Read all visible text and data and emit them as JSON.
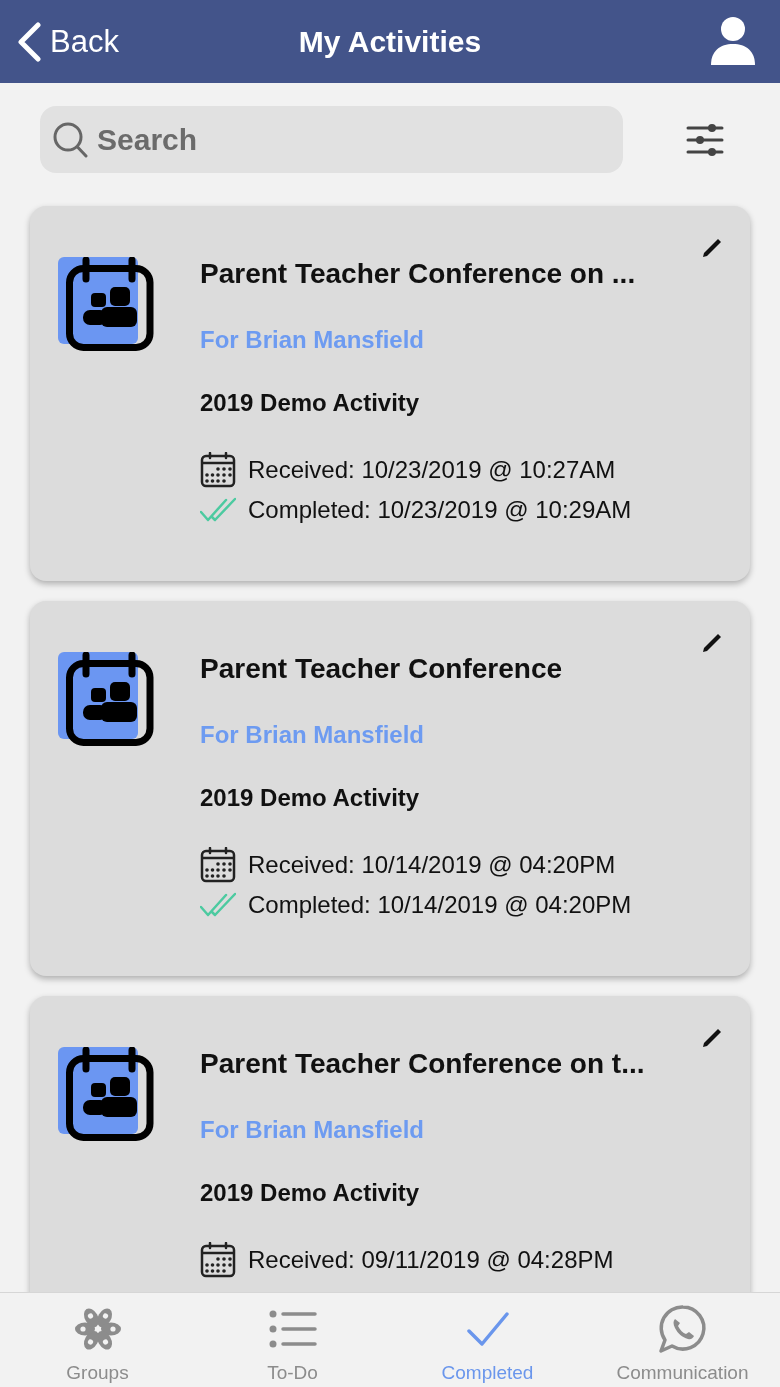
{
  "header": {
    "back_label": "Back",
    "title": "My Activities"
  },
  "search": {
    "placeholder": "Search"
  },
  "activities": [
    {
      "title": "Parent Teacher Conference on ...",
      "recipient": "For Brian Mansfield",
      "activity": "2019 Demo Activity",
      "timestamps": [
        {
          "kind": "received",
          "text": "Received: 10/23/2019 @ 10:27AM"
        },
        {
          "kind": "completed",
          "text": "Completed: 10/23/2019 @ 10:29AM"
        }
      ]
    },
    {
      "title": "Parent Teacher Conference",
      "recipient": "For Brian Mansfield",
      "activity": "2019 Demo Activity",
      "timestamps": [
        {
          "kind": "received",
          "text": "Received: 10/14/2019 @ 04:20PM"
        },
        {
          "kind": "completed",
          "text": "Completed: 10/14/2019 @ 04:20PM"
        }
      ]
    },
    {
      "title": "Parent Teacher Conference on t...",
      "recipient": "For Brian Mansfield",
      "activity": "2019 Demo Activity",
      "timestamps": [
        {
          "kind": "received",
          "text": "Received: 09/11/2019 @ 04:28PM"
        }
      ]
    }
  ],
  "tab_bar": [
    {
      "kind": "groups",
      "label": "Groups",
      "selected": false
    },
    {
      "kind": "todo",
      "label": "To-Do",
      "selected": false
    },
    {
      "kind": "completed",
      "label": "Completed",
      "selected": true
    },
    {
      "kind": "chat",
      "label": "Communication",
      "selected": false
    }
  ]
}
